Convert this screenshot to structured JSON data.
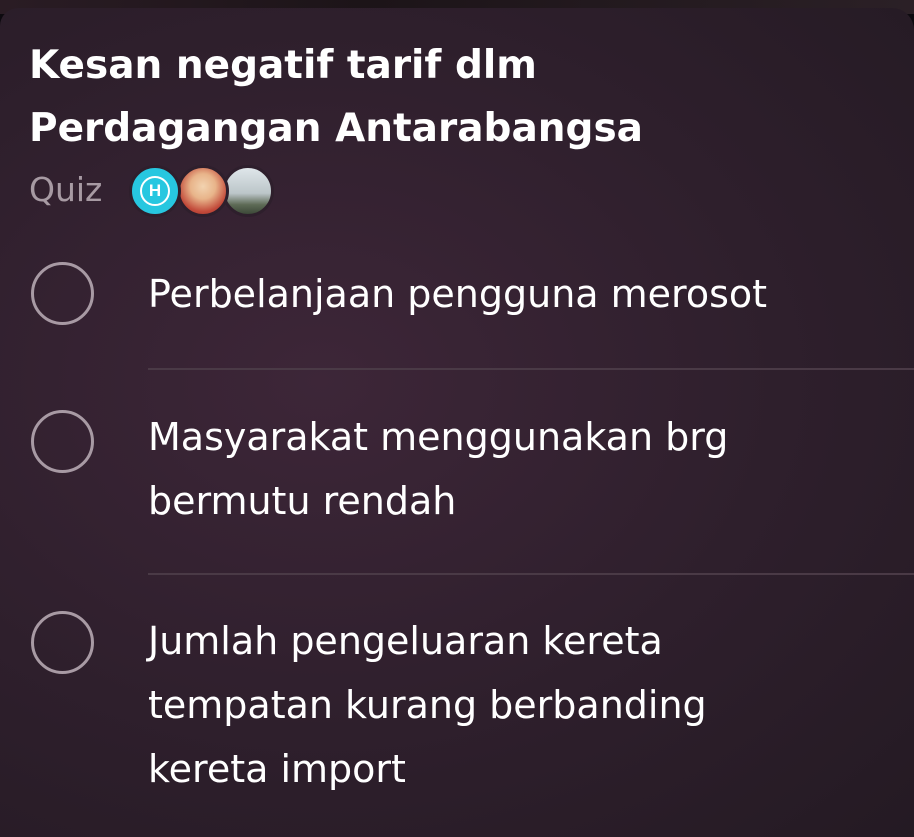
{
  "poll": {
    "title_lines": [
      "Kesan negatif tarif dlm",
      "Perdagangan Antarabangsa"
    ],
    "type_label": "Quiz",
    "participants": [
      {
        "initial": "H",
        "color": "#27c7e0",
        "icon": "letter-avatar"
      },
      {
        "icon": "cartoon-avatar-photo"
      },
      {
        "icon": "landscape-avatar-photo"
      }
    ],
    "options": [
      {
        "lines": [
          "Perbelanjaan pengguna merosot"
        ],
        "selected": false
      },
      {
        "lines": [
          "Masyarakat menggunakan brg",
          "bermutu rendah"
        ],
        "selected": false
      },
      {
        "lines": [
          "Jumlah pengeluaran kereta",
          "tempatan kurang berbanding",
          "kereta import"
        ],
        "selected": false
      }
    ]
  },
  "colors": {
    "card_background": "#2e1f2c",
    "title_text": "#ffffff",
    "muted_text": "#a79aa3",
    "radio_border": "#a89aa4",
    "divider": "#4a3a46"
  }
}
